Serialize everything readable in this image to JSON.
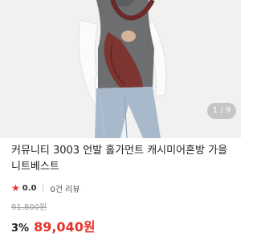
{
  "product": {
    "image_alt": "grey knit vest outfit with burgundy shoulder bag",
    "image_index": "1",
    "image_total": "9",
    "title_line1": "커뮤니티 3003 언발 홀가먼트 캐시미어혼방 가을",
    "title_line2": "니트베스트",
    "rating": "0.0",
    "review_count": "0건 리뷰",
    "original_price": "91,800원",
    "discount": "3%",
    "sale_price": "89,040원"
  },
  "colors": {
    "accent": "#e8322b",
    "text": "#222222",
    "muted": "#9a9a9a"
  },
  "icons": {
    "star": "star-icon"
  }
}
